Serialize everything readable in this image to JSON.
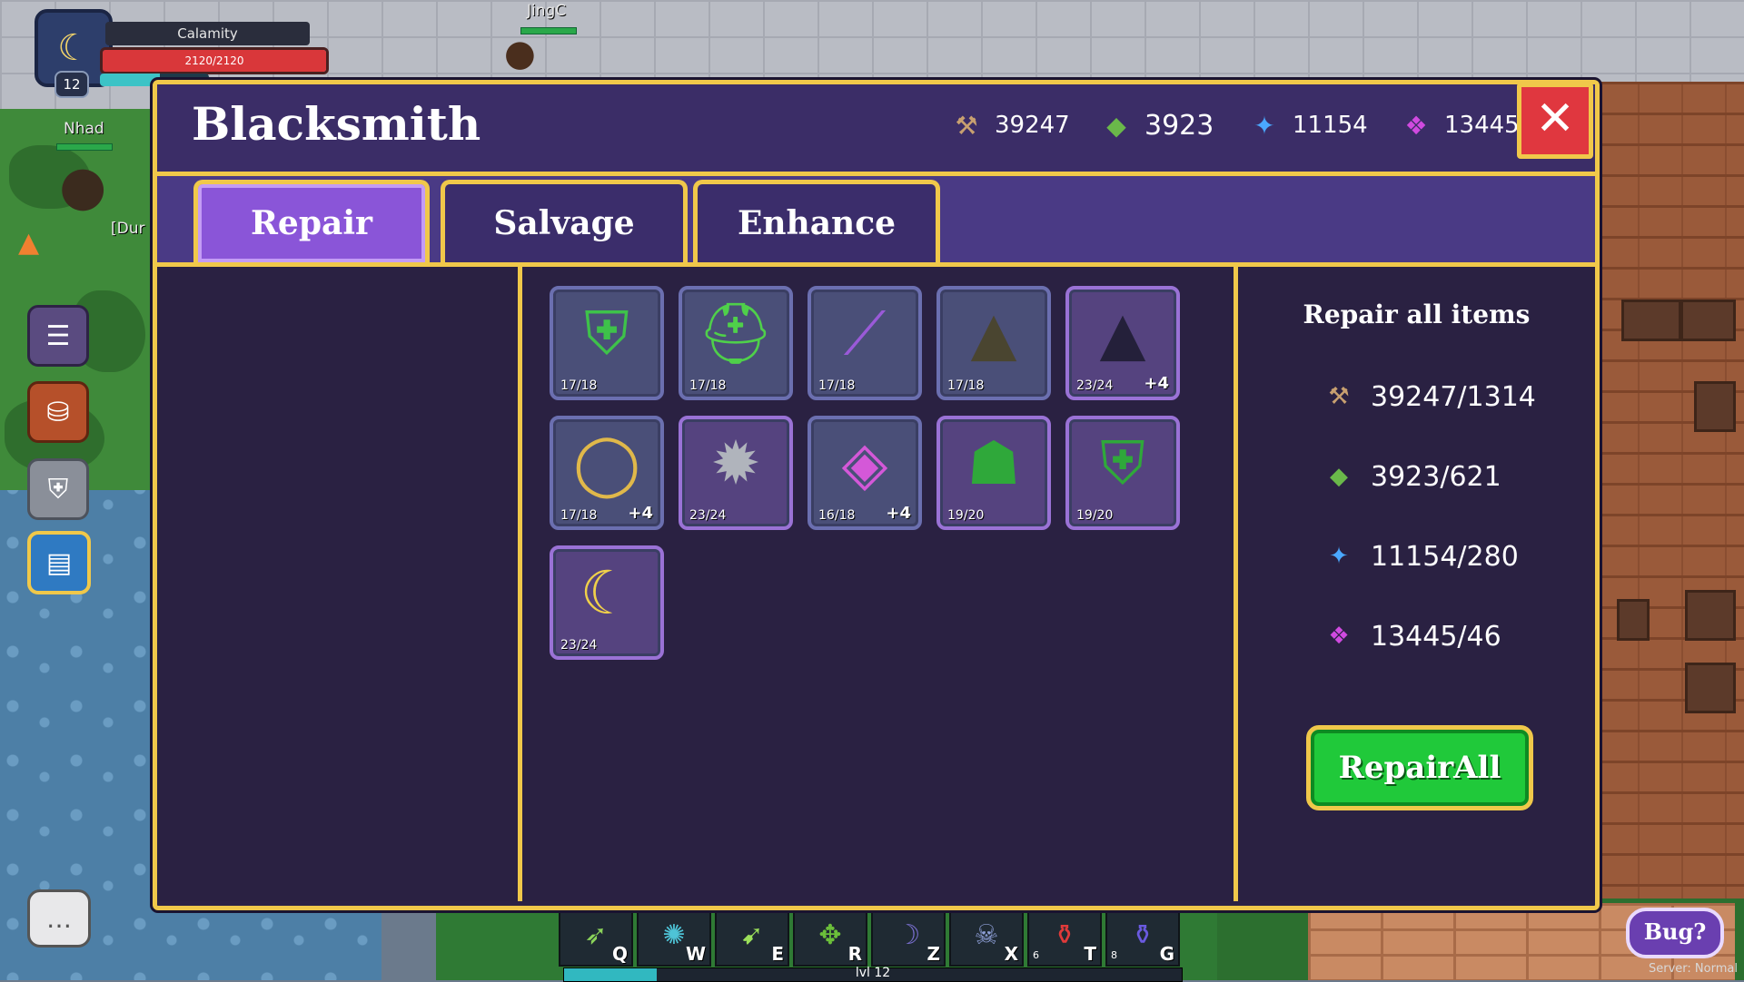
{
  "hud": {
    "player_name": "Calamity",
    "player_hp": "2120/2120",
    "player_hp_fraction": 1.0,
    "player_mp_fraction": 0.55,
    "player_level": "12",
    "ally_1_name": "JingC",
    "ally_2_name": "Nhad",
    "ally_2_suffix": "[Dur",
    "bug_label": "Bug?",
    "server_text": "Server: Normal"
  },
  "panel": {
    "title": "Blacksmith",
    "currencies": [
      {
        "icon": "scrap-icon",
        "value": "39247"
      },
      {
        "icon": "ore-icon",
        "value": "3923"
      },
      {
        "icon": "crystal-icon",
        "value": "11154"
      },
      {
        "icon": "gem-icon",
        "value": "13445"
      }
    ],
    "tabs": [
      {
        "label": "Repair",
        "active": true
      },
      {
        "label": "Salvage",
        "active": false
      },
      {
        "label": "Enhance",
        "active": false
      }
    ],
    "items": [
      {
        "name": "green-armor",
        "durability": "17/18",
        "plus": ""
      },
      {
        "name": "green-helm",
        "durability": "17/18",
        "plus": ""
      },
      {
        "name": "purple-blade",
        "durability": "17/18",
        "plus": ""
      },
      {
        "name": "dark-cloak",
        "durability": "17/18",
        "plus": ""
      },
      {
        "name": "starry-cloak",
        "durability": "23/24",
        "plus": "+4"
      },
      {
        "name": "gold-ring",
        "durability": "17/18",
        "plus": "+4"
      },
      {
        "name": "spiked-shield",
        "durability": "23/24",
        "plus": ""
      },
      {
        "name": "crystal-gauntlet",
        "durability": "16/18",
        "plus": "+4"
      },
      {
        "name": "green-mask",
        "durability": "19/20",
        "plus": ""
      },
      {
        "name": "green-chestplate",
        "durability": "19/20",
        "plus": ""
      },
      {
        "name": "moon-staff",
        "durability": "23/24",
        "plus": ""
      }
    ],
    "repair": {
      "title": "Repair all items",
      "costs": [
        {
          "icon": "scrap-icon",
          "value": "39247/1314"
        },
        {
          "icon": "ore-icon",
          "value": "3923/621"
        },
        {
          "icon": "crystal-icon",
          "value": "11154/280"
        },
        {
          "icon": "gem-icon",
          "value": "13445/46"
        }
      ],
      "button_label": "RepairAll"
    }
  },
  "skills": [
    {
      "key": "Q",
      "count": ""
    },
    {
      "key": "W",
      "count": ""
    },
    {
      "key": "E",
      "count": ""
    },
    {
      "key": "R",
      "count": ""
    },
    {
      "key": "Z",
      "count": ""
    },
    {
      "key": "X",
      "count": ""
    },
    {
      "key": "T",
      "count": "6"
    },
    {
      "key": "G",
      "count": "8"
    }
  ],
  "xp": {
    "label": "lvl 12",
    "fraction": 0.15
  }
}
